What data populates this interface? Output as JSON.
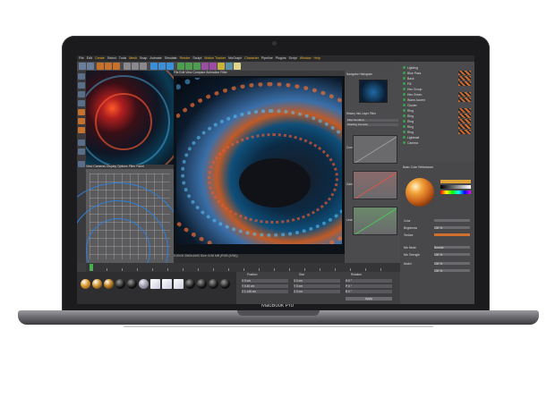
{
  "device": {
    "brand_label": "MacBook Pro"
  },
  "app": {
    "menu": [
      "File",
      "Edit",
      "Create",
      "Select",
      "Tools",
      "Mesh",
      "Snap",
      "Animate",
      "Simulate",
      "Render",
      "Sculpt",
      "Motion Tracker",
      "MoGraph",
      "Character",
      "Pipeline",
      "Plugins",
      "Script",
      "Window",
      "Help"
    ],
    "highlighted_menu": [
      "Create",
      "Mesh",
      "Render",
      "Motion Tracker",
      "Character",
      "Window",
      "Help"
    ],
    "viewport_tabs": [
      "View",
      "Cameras",
      "Display",
      "Options",
      "Filter",
      "Panel"
    ],
    "render_tabs": [
      "File",
      "Edit",
      "View",
      "Compare",
      "Animation",
      "Filter"
    ],
    "navigator_tabs": [
      "Navigator",
      "Histogram"
    ],
    "filter_tabs": [
      "History",
      "Info",
      "Layer",
      "Filter"
    ],
    "filter_labels": [
      "Filter Enabled",
      "Shading Intensity"
    ],
    "curve_labels": [
      "Curve",
      "Gain",
      "Levels"
    ],
    "render_status": "0:00:00  2560x1600  Size: 8.06 MB  (RGB (8 Bit))",
    "objects": [
      {
        "name": "Lighting"
      },
      {
        "name": "Blue Pass"
      },
      {
        "name": "Back"
      },
      {
        "name": "Fill"
      },
      {
        "name": "Hex Group"
      },
      {
        "name": "Hex Green"
      },
      {
        "name": "Warm Accent"
      },
      {
        "name": "Cluster"
      },
      {
        "name": "Ring"
      },
      {
        "name": "Ring"
      },
      {
        "name": "Ring"
      },
      {
        "name": "Ring"
      },
      {
        "name": "Ring"
      },
      {
        "name": "Lightwall"
      },
      {
        "name": "Camera"
      }
    ],
    "attributes": {
      "tabs": [
        "Basic",
        "Color",
        "Reflectance"
      ],
      "sections": [
        "Color",
        "Brightness",
        "Texture",
        "Mix Mode",
        "Mix Strength",
        "Model"
      ],
      "values": [
        "100 %",
        "100 %",
        "100 %",
        "100 %",
        "Normal"
      ]
    },
    "coords": {
      "headers": [
        "Position",
        "Size",
        "Rotation"
      ],
      "rows": [
        [
          "X  0 cm",
          "X  0 cm",
          "H  0 °"
        ],
        [
          "Y  0.45 cm",
          "Y  0 cm",
          "P  0 °"
        ],
        [
          "Z  1.148 cm",
          "Z  0 cm",
          "B  0 °"
        ]
      ],
      "apply_label": "Apply"
    },
    "colors": {
      "accent_green": "#3fb24c",
      "accent_orange": "#f0b429",
      "ui_dark": "#3d3d3f"
    }
  }
}
